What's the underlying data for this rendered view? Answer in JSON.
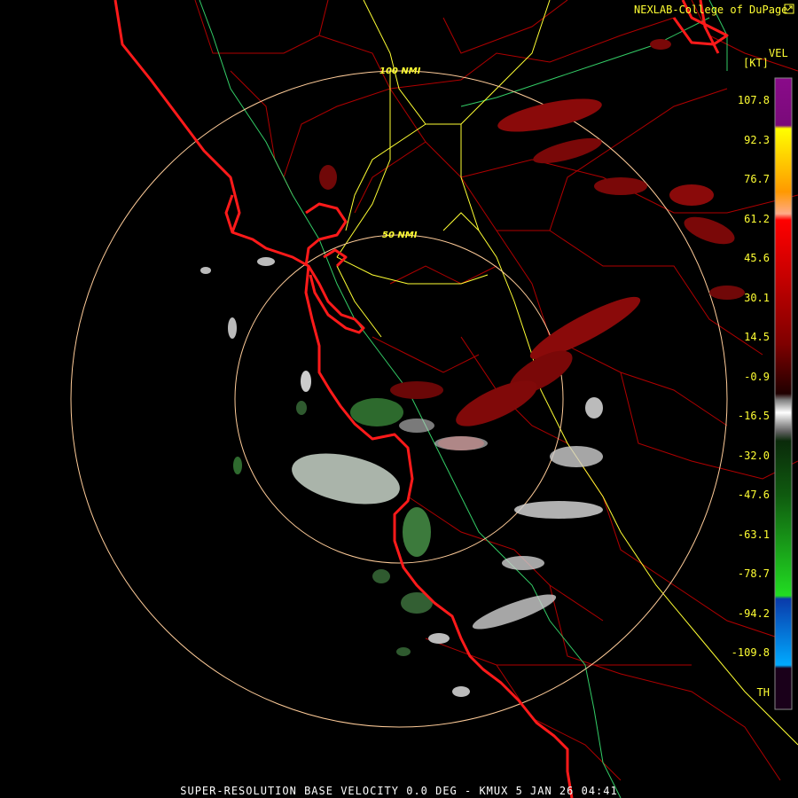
{
  "credit": "NEXLAB-College of DuPage",
  "credit_icon": "external-link-icon",
  "legend": {
    "product": "VEL",
    "units": "[KT]",
    "ticks": [
      "107.8",
      "92.3",
      "76.7",
      "61.2",
      "45.6",
      "30.1",
      "14.5",
      "-0.9",
      "-16.5",
      "-32.0",
      "-47.6",
      "-63.1",
      "-78.7",
      "-94.2",
      "-109.8",
      "TH"
    ]
  },
  "range_rings": [
    "100 NMI",
    "50 NMI"
  ],
  "footer": "SUPER-RESOLUTION BASE VELOCITY 0.0 DEG - KMUX 5 JAN 26 04:41",
  "colors": {
    "background": "#000000",
    "coastline": "#ff1a1a",
    "county_lines": "#b00000",
    "highways": "#ffff33",
    "rivers": "#33cc66",
    "rings": "#ffcc99",
    "label_text": "#ffff33"
  }
}
